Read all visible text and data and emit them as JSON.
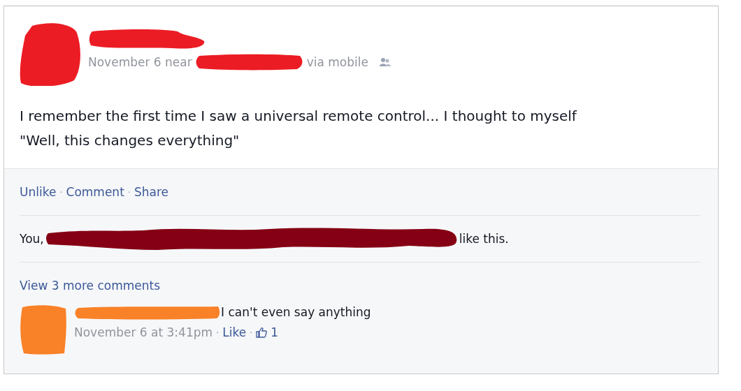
{
  "post": {
    "meta": {
      "date": "November 6 near",
      "via": "via mobile"
    },
    "text_lines": [
      "I remember the first time I saw a universal remote control... I thought to myself",
      "\"Well, this changes everything\""
    ]
  },
  "actions": [
    {
      "kind": "link",
      "text": "Unlike"
    },
    {
      "kind": "separator",
      "text": "·"
    },
    {
      "kind": "link",
      "text": "Comment"
    },
    {
      "kind": "separator",
      "text": "·"
    },
    {
      "kind": "link",
      "text": "Share"
    }
  ],
  "likes": {
    "prefix": "You,",
    "suffix": "like this."
  },
  "view_more": "View 3 more comments",
  "comment": {
    "text": "I can't even say anything",
    "meta": [
      {
        "kind": "time",
        "text": "November 6 at 3:41pm"
      },
      {
        "kind": "separator",
        "text": "·"
      },
      {
        "kind": "link",
        "text": "Like"
      },
      {
        "kind": "separator",
        "text": "·"
      },
      {
        "kind": "likes",
        "text": "1"
      }
    ]
  }
}
